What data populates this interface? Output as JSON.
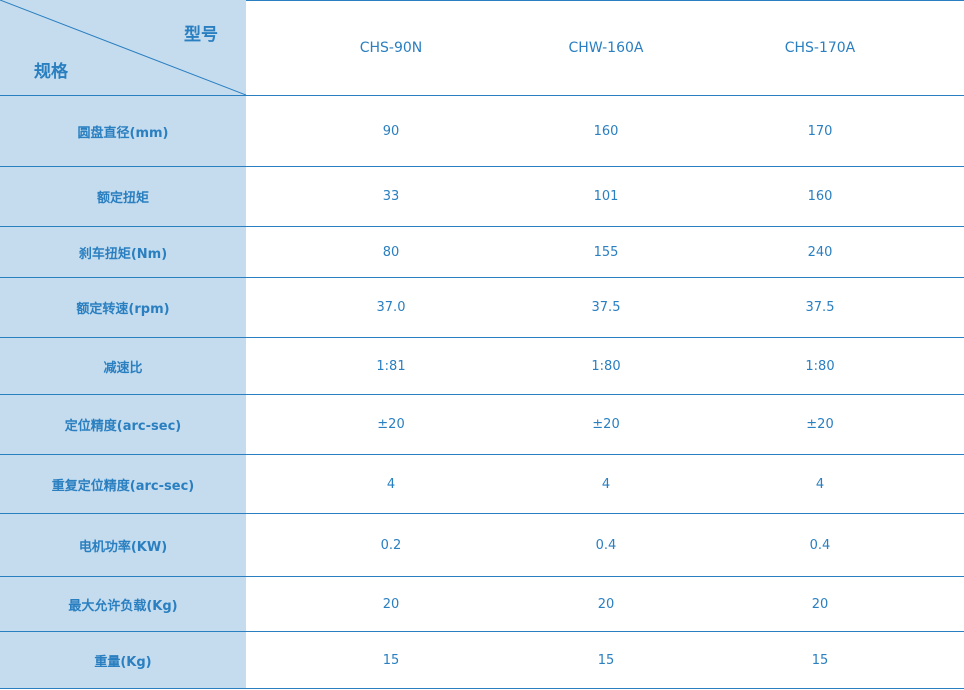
{
  "header": {
    "model_label": "型号",
    "spec_label": "规格",
    "models": [
      "CHS-90N",
      "CHW-160A",
      "CHS-170A"
    ]
  },
  "rows": [
    {
      "label": "圆盘直径(mm)",
      "values": [
        "90",
        "160",
        "170"
      ]
    },
    {
      "label": "额定扭矩",
      "values": [
        "33",
        "101",
        "160"
      ]
    },
    {
      "label": "刹车扭矩(Nm)",
      "values": [
        "80",
        "155",
        "240"
      ]
    },
    {
      "label": "额定转速(rpm)",
      "values": [
        "37.0",
        "37.5",
        "37.5"
      ]
    },
    {
      "label": "减速比",
      "values": [
        "1:81",
        "1:80",
        "1:80"
      ]
    },
    {
      "label": "定位精度(arc-sec)",
      "values": [
        "±20",
        "±20",
        "±20"
      ]
    },
    {
      "label": "重复定位精度(arc-sec)",
      "values": [
        "4",
        "4",
        "4"
      ]
    },
    {
      "label": "电机功率(KW)",
      "values": [
        "0.2",
        "0.4",
        "0.4"
      ]
    },
    {
      "label": "最大允许负载(Kg)",
      "values": [
        "20",
        "20",
        "20"
      ]
    },
    {
      "label": "重量(Kg)",
      "values": [
        "15",
        "15",
        "15"
      ]
    }
  ],
  "colors": {
    "accent": "#2a7fc0",
    "label_bg": "#c5dcef"
  }
}
